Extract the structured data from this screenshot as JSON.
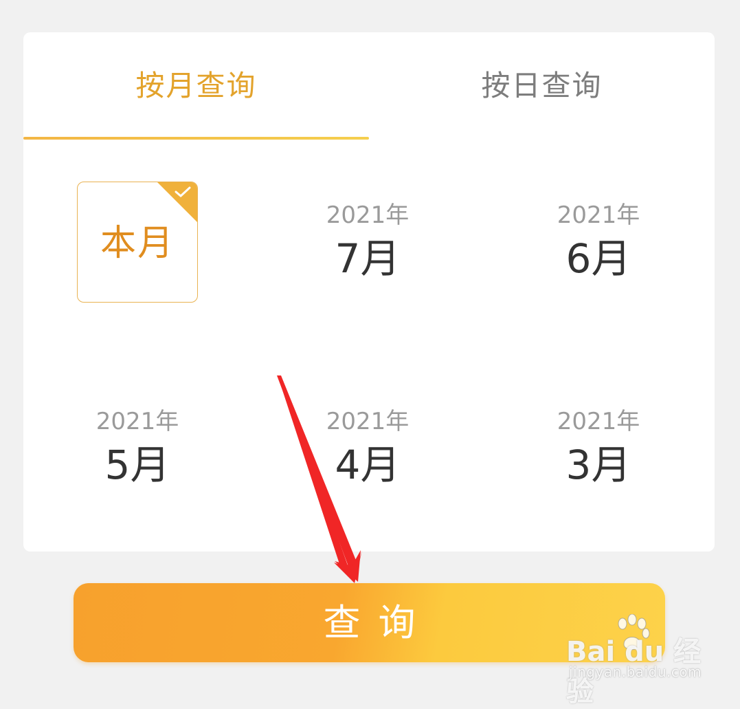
{
  "tabs": {
    "by_month": "按月查询",
    "by_day": "按日查询"
  },
  "current_month": {
    "label": "本月",
    "selected": true
  },
  "months": [
    {
      "year": "2021年",
      "month": "7月"
    },
    {
      "year": "2021年",
      "month": "6月"
    },
    {
      "year": "2021年",
      "month": "5月"
    },
    {
      "year": "2021年",
      "month": "4月"
    },
    {
      "year": "2021年",
      "month": "3月"
    }
  ],
  "query_button": {
    "label": "查询"
  },
  "watermark": {
    "brand": "Bai du 经验",
    "url": "jingyan.baidu.com"
  },
  "colors": {
    "accent": "#e3a32c",
    "button_start": "#f7a12d",
    "button_end": "#fdd24a",
    "annotation_arrow": "#f02626"
  }
}
